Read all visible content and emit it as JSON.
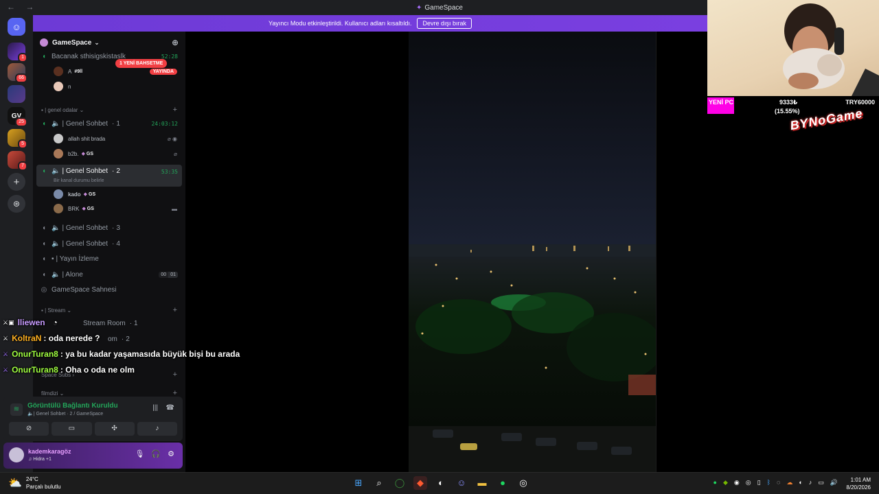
{
  "window": {
    "title": "GameSpace",
    "nav_back": "←",
    "nav_forward": "→"
  },
  "banner": {
    "text": "Yayıncı Modu etkinleştirildi. Kullanıcı adları kısaltıldı.",
    "button": "Devre dışı bırak"
  },
  "rail": {
    "badges": [
      "1",
      "66",
      "25",
      "5",
      "7"
    ]
  },
  "server": {
    "name": "GameSpace",
    "chevron": "⌄"
  },
  "channels": {
    "top": {
      "name": "Bacanak sthisigskistaslk",
      "time": "52:28"
    },
    "top_users": [
      {
        "name": "A",
        "tag": "#9ll",
        "live": "YAYINDA"
      },
      {
        "name": "n"
      }
    ],
    "mention": "1 YENİ BAHSETME",
    "category_general": "| genel odalar",
    "general1": {
      "name": "| Genel Sohbet",
      "count": "1",
      "time": "24:03:12"
    },
    "general1_users": [
      {
        "name": "allah shit brada"
      },
      {
        "name": "b2b.",
        "tag": "GS"
      }
    ],
    "general2": {
      "name": "| Genel Sohbet",
      "count": "2",
      "time": "53:35",
      "status": "Bir kanal durumu belirle"
    },
    "general2_users": [
      {
        "name": "kado",
        "tag": "GS"
      },
      {
        "name": "BRK",
        "tag": "GS"
      }
    ],
    "general3": {
      "name": "| Genel Sohbet",
      "count": "3"
    },
    "general4": {
      "name": "| Genel Sohbet",
      "count": "4"
    },
    "yayin": {
      "name": "| Yayın İzleme"
    },
    "alone": {
      "name": "| Alone",
      "lim_a": "00",
      "lim_b": "01"
    },
    "stage": {
      "name": "GameSpace Sahnesi"
    },
    "category_stream": "| Stream",
    "stream1": {
      "name": "Stream Room",
      "count": "1"
    },
    "stream2": {
      "name": "om",
      "count": "2"
    },
    "category_subs": "Space Subs",
    "category_film": "filmdizi"
  },
  "voice": {
    "status": "Görüntülü Bağlantı Kuruldu",
    "channel": "| Genel Sohbet",
    "channel_sep": "2 / GameSpace"
  },
  "user_panel": {
    "name": "kademkaragöz",
    "activity": "Hidra +1"
  },
  "goal": {
    "label": "YENİ PC",
    "amount": "9333₺",
    "percent": "(15.55%)",
    "target": "TRY60000",
    "progress": 0.1555
  },
  "logo": "BYNoGame",
  "chat": [
    {
      "name": "lliewen",
      "name_color": "#c89bff",
      "message": ""
    },
    {
      "name": "KoltraN",
      "name_color": "#ffb020",
      "message": ": oda nerede ?"
    },
    {
      "name": "OnurTuran8",
      "name_color": "#a0ff40",
      "message": ": ya bu kadar yaşamasıda büyük bişi bu arada"
    },
    {
      "name": "OnurTuran8",
      "name_color": "#a0ff40",
      "message": ": Oha o oda ne olm"
    }
  ],
  "taskbar": {
    "temp": "24°C",
    "weather": "Parçalı bulutlu",
    "time": "1:01 AM",
    "date": "8/20/2026"
  }
}
